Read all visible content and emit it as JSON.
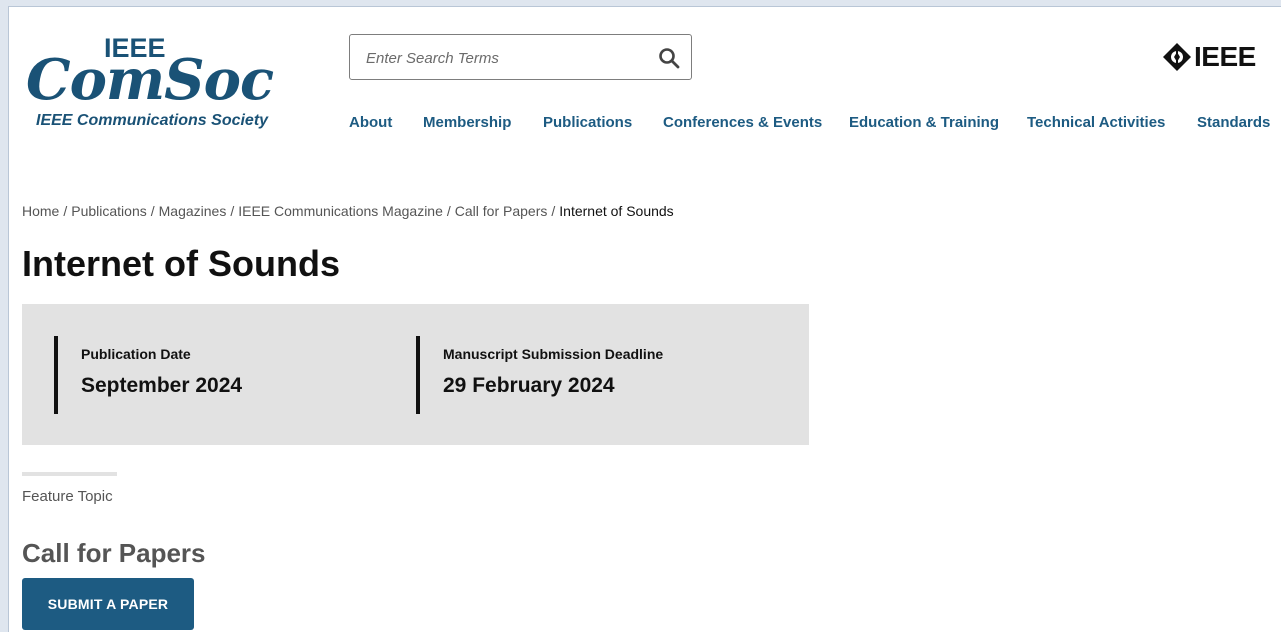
{
  "logo": {
    "top_text": "IEEE",
    "main_text": "ComSoc",
    "registered": "®",
    "subtitle": "IEEE Communications Society"
  },
  "search": {
    "placeholder": "Enter Search Terms",
    "value": "",
    "icon": "search-icon"
  },
  "brand": {
    "text": "IEEE",
    "icon": "ieee-diamond-icon"
  },
  "nav": {
    "items": [
      {
        "label": "About"
      },
      {
        "label": "Membership"
      },
      {
        "label": "Publications"
      },
      {
        "label": "Conferences & Events"
      },
      {
        "label": "Education & Training"
      },
      {
        "label": "Technical Activities"
      },
      {
        "label": "Standards"
      }
    ]
  },
  "breadcrumb": {
    "items": [
      "Home",
      "Publications",
      "Magazines",
      "IEEE Communications Magazine",
      "Call for Papers"
    ],
    "separator": "/",
    "current": "Internet of Sounds"
  },
  "page": {
    "title": "Internet of Sounds"
  },
  "dates": [
    {
      "label": "Publication Date",
      "value": "September 2024"
    },
    {
      "label": "Manuscript Submission Deadline",
      "value": "29 February 2024"
    }
  ],
  "feature": {
    "label": "Feature Topic"
  },
  "call": {
    "heading": "Call for Papers",
    "button_label": "SUBMIT A PAPER"
  },
  "colors": {
    "brand_blue": "#1d5b82",
    "logo_blue": "#1a5276",
    "box_gray": "#e2e2e2"
  }
}
